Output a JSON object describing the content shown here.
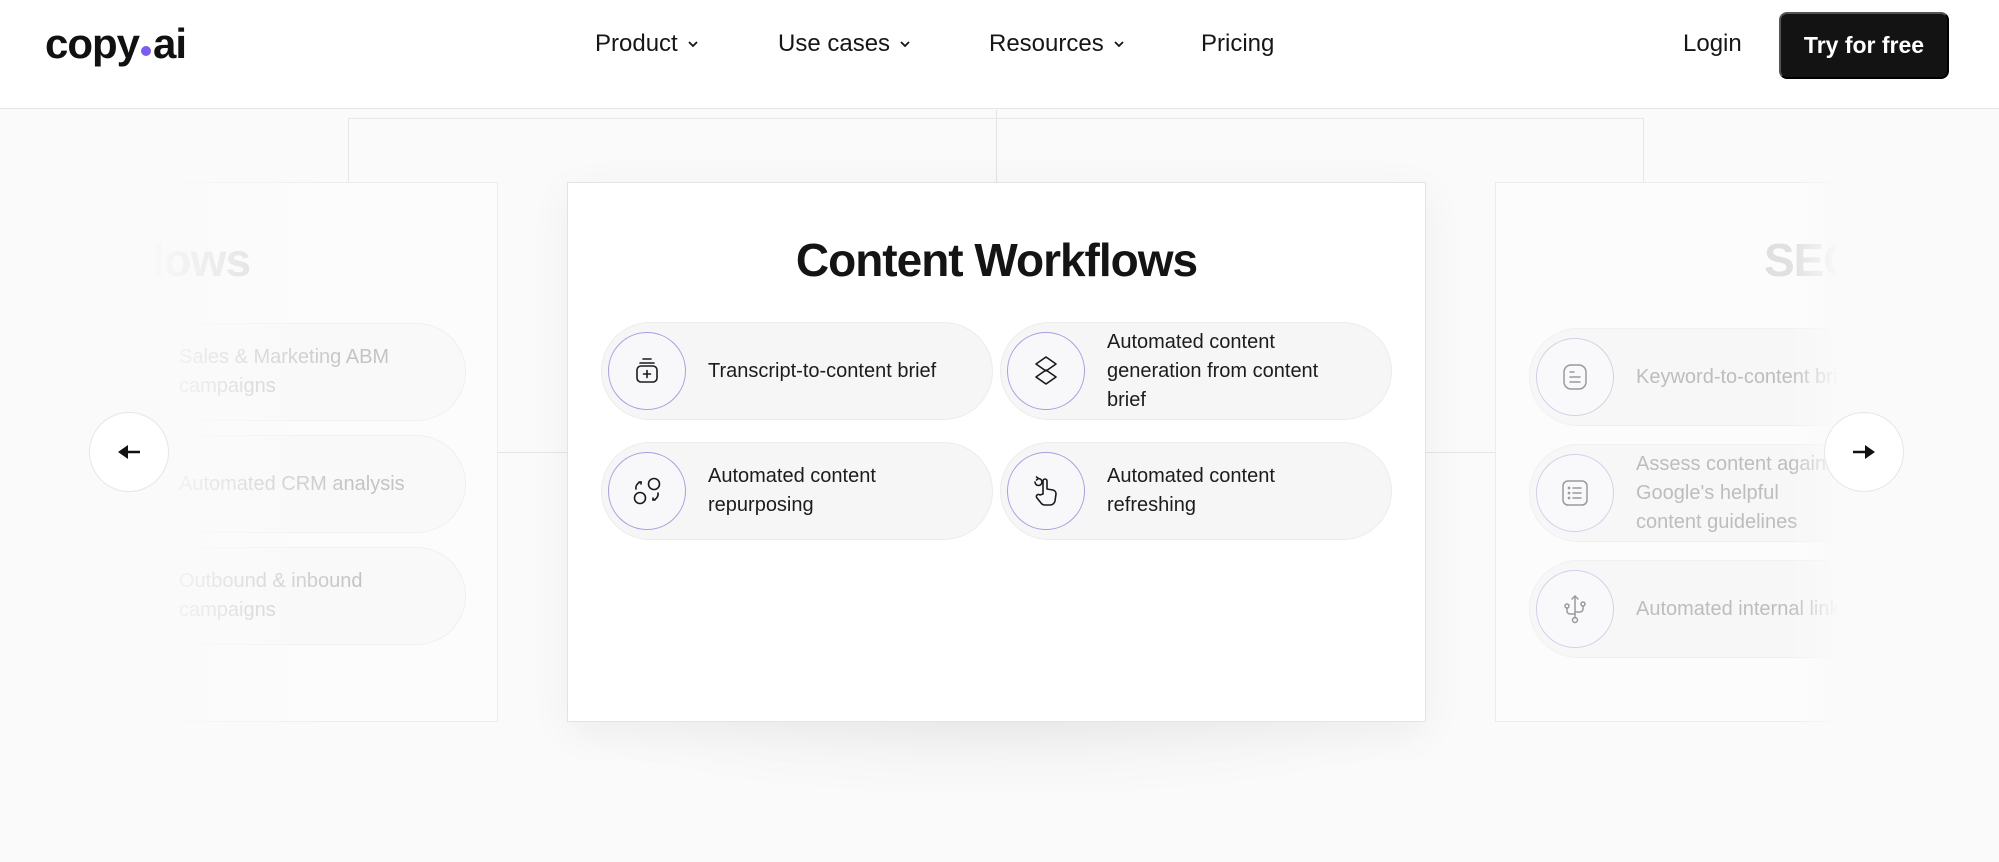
{
  "brand": {
    "logo_text_a": "copy",
    "logo_text_b": "ai",
    "accent_color": "#7b5cf0"
  },
  "nav": {
    "items": [
      {
        "label": "Product",
        "has_dropdown": true,
        "icon": "chevron-down-icon"
      },
      {
        "label": "Use cases",
        "has_dropdown": true,
        "icon": "chevron-down-icon"
      },
      {
        "label": "Resources",
        "has_dropdown": true,
        "icon": "chevron-down-icon"
      },
      {
        "label": "Pricing",
        "has_dropdown": false
      }
    ],
    "login_label": "Login",
    "cta_label": "Try for free"
  },
  "carousel": {
    "prev_icon": "arrow-left-icon",
    "next_icon": "arrow-right-icon",
    "left_card": {
      "title_partial": "rkflows",
      "items": [
        {
          "label": "Sales & Marketing ABM campaigns"
        },
        {
          "label": "Automated CRM analysis"
        },
        {
          "label": "Outbound & inbound campaigns"
        }
      ]
    },
    "center_card": {
      "title": "Content Workflows",
      "items": [
        {
          "label": "Transcript-to-content brief",
          "icon": "add-note-icon"
        },
        {
          "label": "Automated content generation from content brief",
          "icon": "layers-icon"
        },
        {
          "label": "Automated content repurposing",
          "icon": "recycle-shapes-icon"
        },
        {
          "label": "Automated content refreshing",
          "icon": "tap-refresh-icon"
        }
      ]
    },
    "right_card": {
      "title_partial": "SEO",
      "items": [
        {
          "label": "Keyword-to-content brief",
          "icon": "document-lines-icon"
        },
        {
          "label": "Assess content against Google's helpful content guidelines",
          "icon": "list-icon"
        },
        {
          "label": "Automated internal linking",
          "icon": "usb-branch-icon"
        }
      ]
    }
  }
}
